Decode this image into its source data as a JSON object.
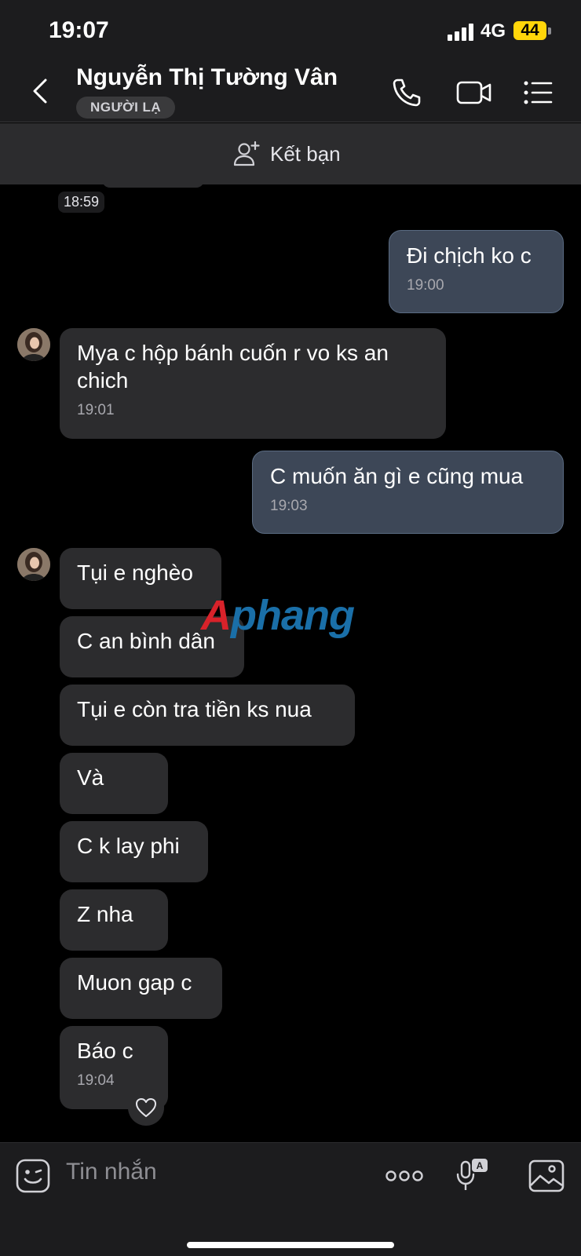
{
  "status_bar": {
    "time": "19:07",
    "network": "4G",
    "battery": "44"
  },
  "header": {
    "contact_name": "Nguyễn Thị Tường Vân",
    "badge": "NGƯỜI LẠ"
  },
  "add_friend": {
    "label": "Kết bạn"
  },
  "chat": {
    "top_time": "18:59",
    "messages": [
      {
        "dir": "out",
        "text": "Đi chịch ko c",
        "time": "19:00"
      },
      {
        "dir": "in",
        "text": "Mya c hộp bánh cuốn r vo ks an chich",
        "time": "19:01"
      },
      {
        "dir": "out",
        "text": "C muốn ăn gì e cũng mua",
        "time": "19:03"
      },
      {
        "dir": "in",
        "text": "Tụi e nghèo"
      },
      {
        "dir": "in",
        "text": "C an bình dân"
      },
      {
        "dir": "in",
        "text": "Tụi e còn tra tiền ks nua"
      },
      {
        "dir": "in",
        "text": "Và"
      },
      {
        "dir": "in",
        "text": "C k lay phi"
      },
      {
        "dir": "in",
        "text": "Z nha"
      },
      {
        "dir": "in",
        "text": "Muon gap c"
      },
      {
        "dir": "in",
        "text": "Báo c",
        "time": "19:04"
      }
    ]
  },
  "watermark": {
    "part1": "A",
    "part2": "phang"
  },
  "composer": {
    "placeholder": "Tin nhắn"
  },
  "colors": {
    "incoming_bubble": "#2c2c2e",
    "outgoing_bubble": "#3d4757",
    "background": "#000000",
    "battery": "#ffd60a"
  },
  "icons": [
    "back-icon",
    "phone-icon",
    "video-icon",
    "menu-icon",
    "add-friend-icon",
    "heart-icon",
    "sticker-icon",
    "more-icon",
    "voice-to-text-icon",
    "image-icon"
  ]
}
